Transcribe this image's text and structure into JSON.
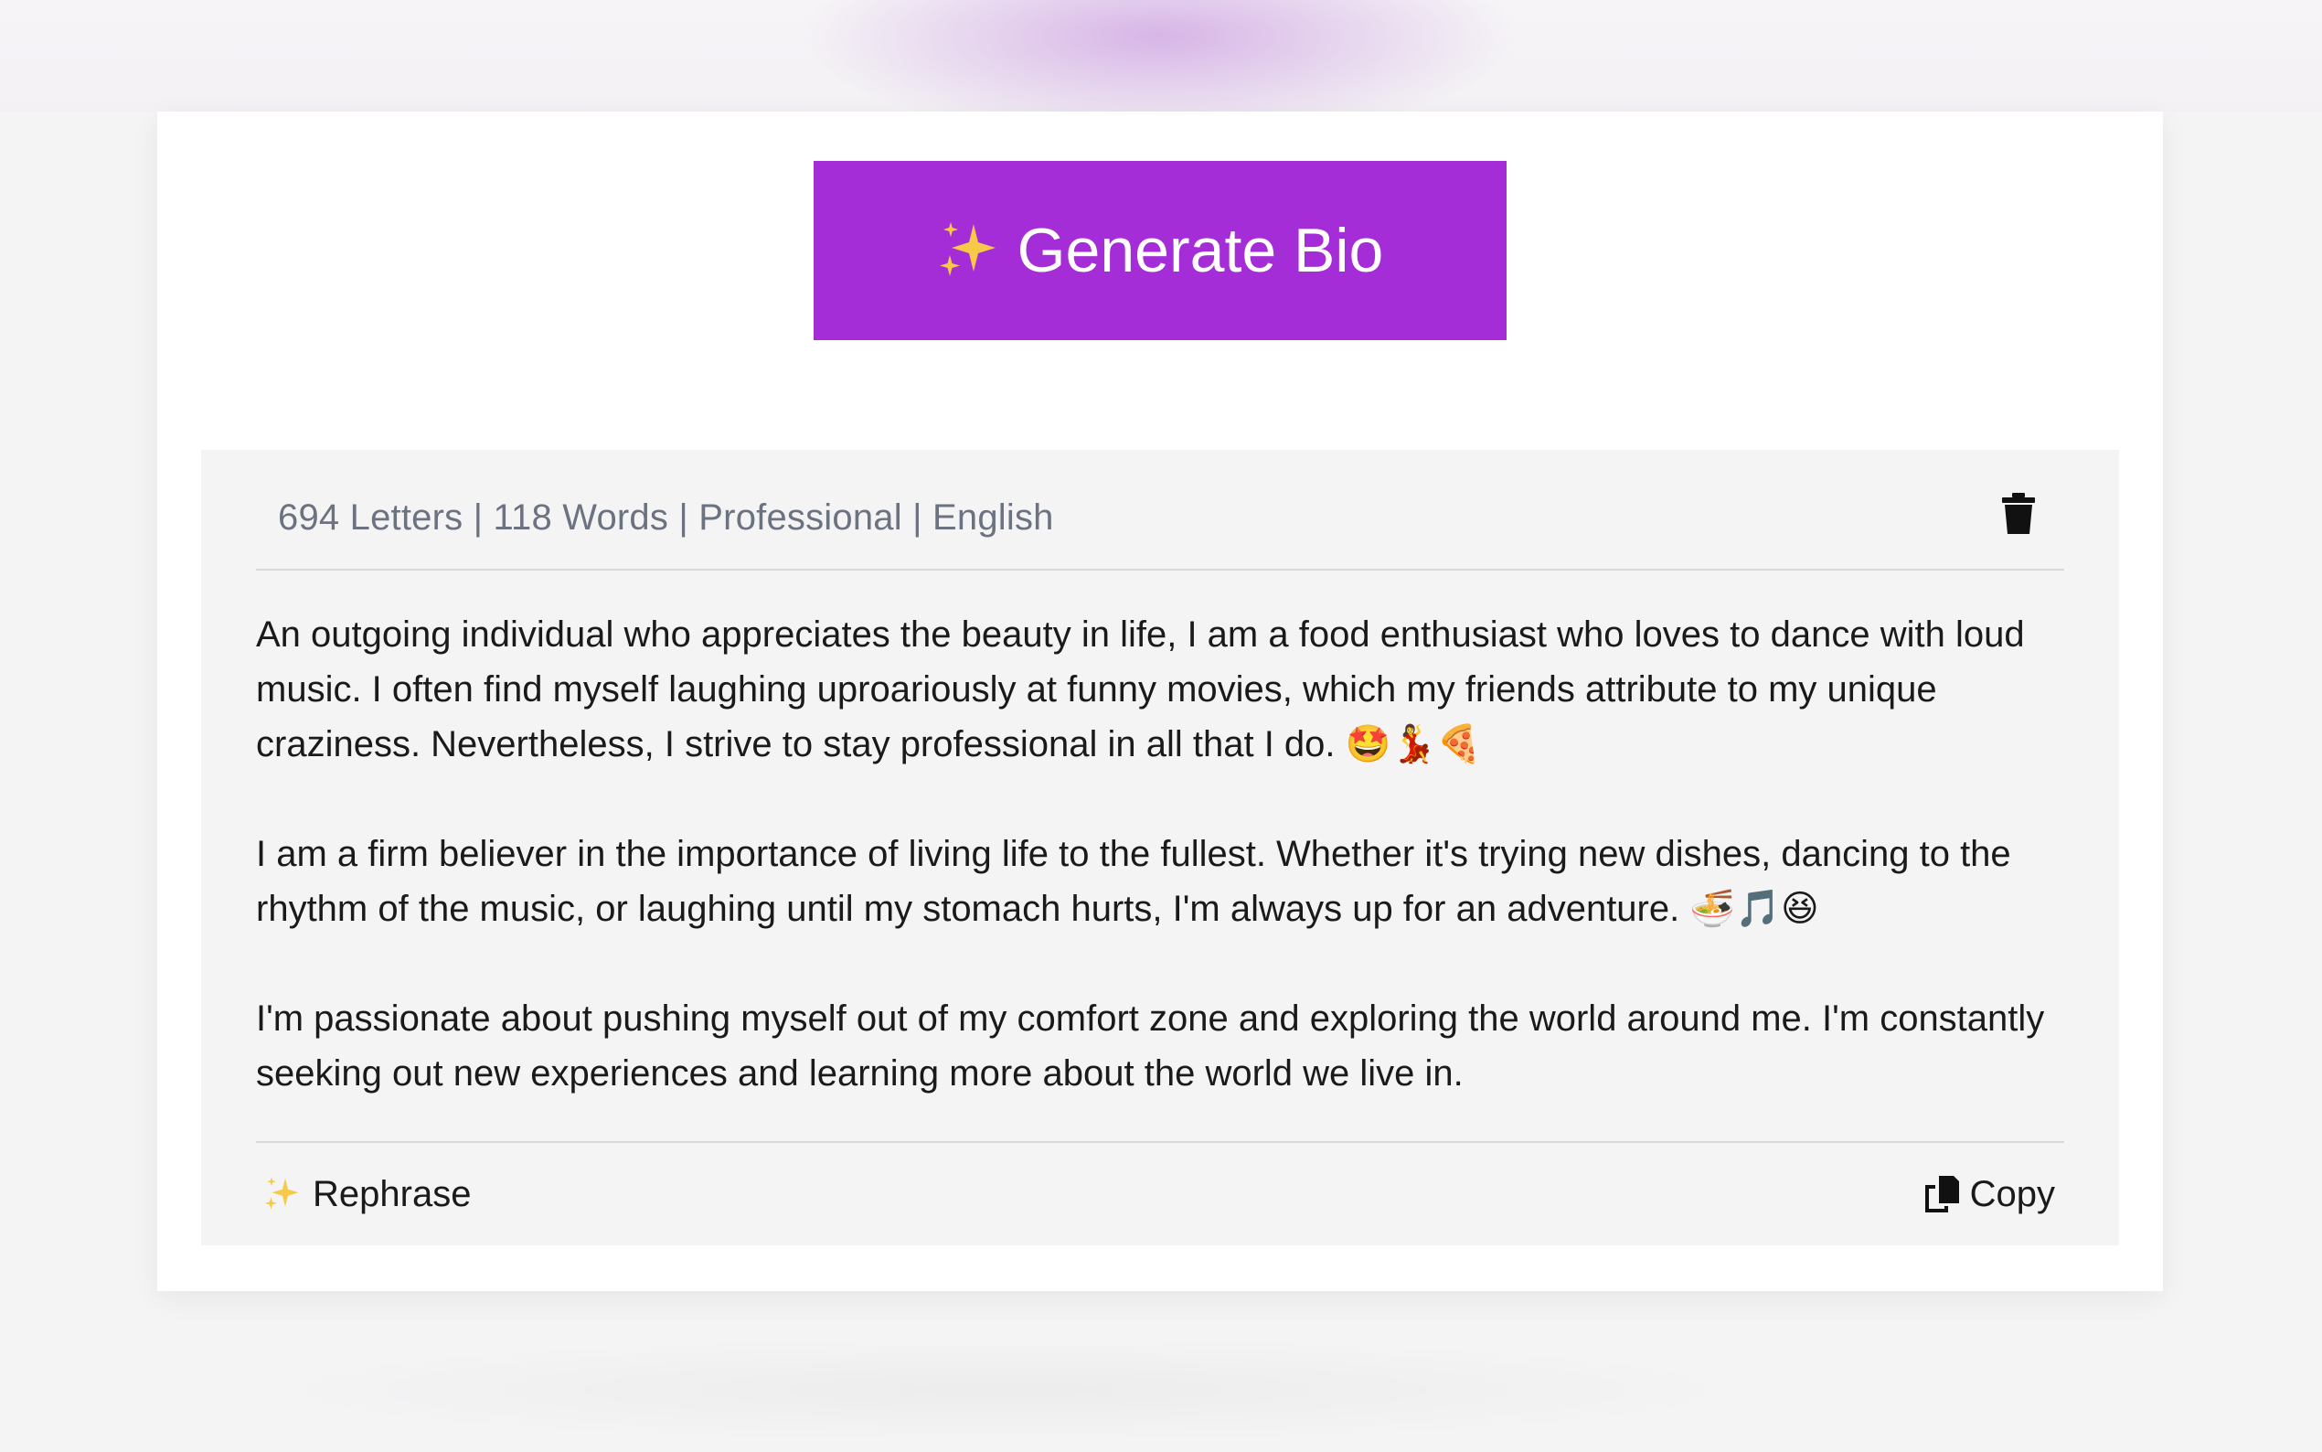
{
  "generate": {
    "label": "Generate Bio",
    "icon": "sparkles-icon",
    "color": "#a42dd7"
  },
  "result": {
    "meta": "694 Letters | 118 Words | Professional | English",
    "delete_icon": "trash-icon",
    "paragraphs": [
      "An outgoing individual who appreciates the beauty in life, I am a food enthusiast who loves to dance with loud music. I often find myself laughing uproariously at funny movies, which my friends attribute to my unique craziness. Nevertheless, I strive to stay professional in all that I do. 🤩💃🍕",
      "I am a firm believer in the importance of living life to the fullest. Whether it's trying new dishes, dancing to the rhythm of the music, or laughing until my stomach hurts, I'm always up for an adventure. 🍜🎵😆",
      "I'm passionate about pushing myself out of my comfort zone and exploring the world around me. I'm constantly seeking out new experiences and learning more about the world we live in."
    ],
    "rephrase_label": "Rephrase",
    "copy_label": "Copy",
    "copy_icon": "copy-icon"
  }
}
